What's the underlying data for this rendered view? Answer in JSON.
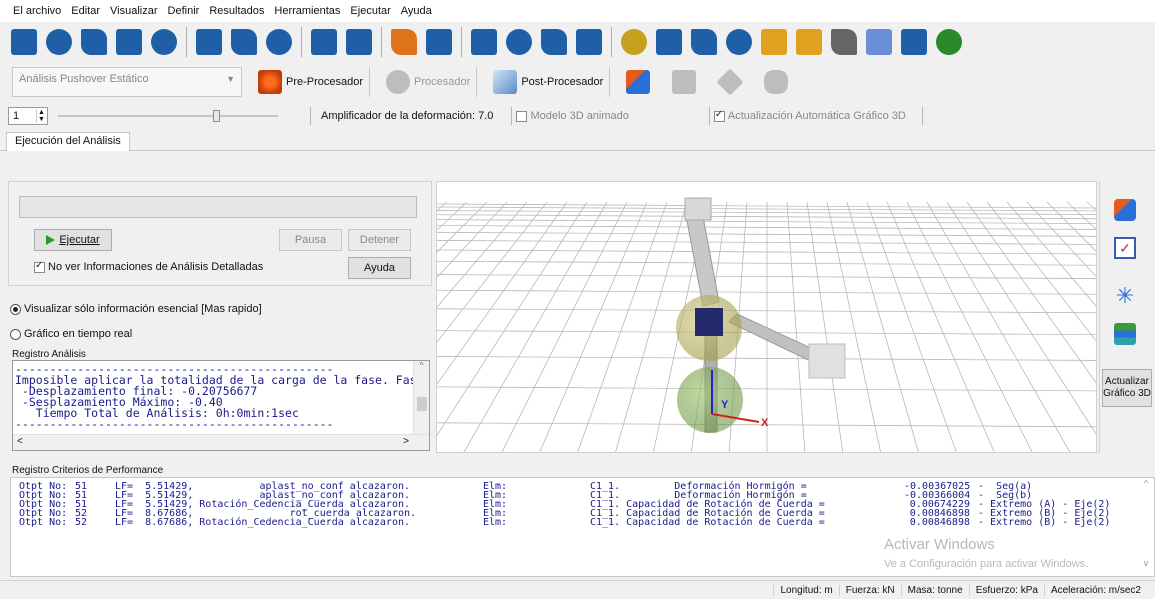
{
  "menu": [
    "El archivo",
    "Editar",
    "Visualizar",
    "Definir",
    "Resultados",
    "Herramientas",
    "Ejecutar",
    "Ayuda"
  ],
  "toolbar_icons": [
    {
      "name": "new-icon",
      "color": "#1f5fa8"
    },
    {
      "name": "open-icon",
      "color": "#1f5fa8"
    },
    {
      "name": "save-icon",
      "color": "#1f5fa8"
    },
    {
      "name": "properties-icon",
      "color": "#1f5fa8"
    },
    {
      "name": "disk-icon",
      "color": "#1f5fa8"
    },
    {
      "name": "report-icon",
      "color": "#1f5fa8"
    },
    {
      "name": "print-icon",
      "color": "#1f5fa8"
    },
    {
      "name": "print-preview-icon",
      "color": "#1f5fa8"
    },
    {
      "name": "undo-icon",
      "color": "#1f5fa8"
    },
    {
      "name": "redo-icon",
      "color": "#1f5fa8"
    },
    {
      "name": "table-icon",
      "color": "#e0721a"
    },
    {
      "name": "table-edit-icon",
      "color": "#1f5fa8"
    },
    {
      "name": "tree-icon",
      "color": "#1f5fa8"
    },
    {
      "name": "stop-icon",
      "color": "#1f5fa8"
    },
    {
      "name": "settings-icon",
      "color": "#1f5fa8"
    },
    {
      "name": "gear-icon",
      "color": "#1f5fa8"
    },
    {
      "name": "brush-icon",
      "color": "#c8a020"
    },
    {
      "name": "help-icon",
      "color": "#1f5fa8"
    },
    {
      "name": "book-icon",
      "color": "#1f5fa8"
    },
    {
      "name": "book-check-icon",
      "color": "#1f5fa8"
    },
    {
      "name": "folder-icon",
      "color": "#e0a020"
    },
    {
      "name": "chat-icon",
      "color": "#e0a020"
    },
    {
      "name": "film-icon",
      "color": "#666666"
    },
    {
      "name": "speech-icon",
      "color": "#6b8fd6"
    },
    {
      "name": "pen-icon",
      "color": "#1f5fa8"
    },
    {
      "name": "globe-icon",
      "color": "#2a8a2a"
    }
  ],
  "analysis_type": "Análisis Pushover Estático",
  "modes": {
    "pre": "Pre-Procesador",
    "proc": "Procesador",
    "post": "Post-Procesador"
  },
  "toolbar3": {
    "step_value": "1",
    "slider_fraction": 0.73,
    "amplifier": "Amplificador de la deformación: 7.0",
    "model3d": "Modelo 3D animado",
    "autoupdate": "Actualización Automática Gráfico 3D"
  },
  "tab": "Ejecución del Análisis",
  "controls": {
    "run": "Ejecutar",
    "pause": "Pausa",
    "stop": "Detener",
    "no_info": "No ver Informaciones de Análisis Detalladas",
    "help": "Ayuda",
    "opt_essential": "Visualizar sólo información esencial [Mas rapido]",
    "opt_realtime": "Gráfico en tiempo real"
  },
  "registro_label": "Registro Análisis",
  "console_lines": [
    "----------------------------------------------",
    "Imposible aplicar la totalidad de la carga de la fase. Fase",
    " -Desplazamiento final: -0.20756677",
    " -Sesplazamiento Máximo: -0.40",
    "   Tiempo Total de Análisis: 0h:0min:1sec",
    "----------------------------------------------"
  ],
  "view3d": {
    "axis_x": "X",
    "axis_y": "Y",
    "x_color": "#d62020",
    "y_color": "#2020d6"
  },
  "side": {
    "update": "Actualizar Gráfico 3D"
  },
  "performance_label": "Registro Criterios de Performance",
  "performance_rows": [
    [
      "Otpt No:",
      "51",
      "LF=  5.51429,           aplast_no_conf alcazaron.",
      "Elm:",
      "C1_1.         Deformación Hormigón =",
      "-0.00367025",
      "-  Seg(a)"
    ],
    [
      "Otpt No:",
      "51",
      "LF=  5.51429,           aplast_no_conf alcazaron.",
      "Elm:",
      "C1_1.         Deformación Hormigón =",
      "-0.00366004",
      "-  Seg(b)"
    ],
    [
      "Otpt No:",
      "51",
      "LF=  5.51429, Rotación_Cedencia_Cuerda alcazaron.",
      "Elm:",
      "C1_1. Capacidad de Rotación de Cuerda =",
      "0.00674229",
      "- Extremo (A) - Eje(2)"
    ],
    [
      "Otpt No:",
      "52",
      "LF=  8.67686,                rot_cuerda alcazaron.",
      "Elm:",
      "C1_1. Capacidad de Rotación de Cuerda =",
      "0.00846898",
      "- Extremo (B) - Eje(2)"
    ],
    [
      "Otpt No:",
      "52",
      "LF=  8.67686, Rotación_Cedencia_Cuerda alcazaron.",
      "Elm:",
      "C1_1. Capacidad de Rotación de Cuerda =",
      "0.00846898",
      "- Extremo (B) - Eje(2)"
    ]
  ],
  "watermark": {
    "title": "Activar Windows",
    "sub": "Ve a Configuración para activar Windows."
  },
  "status": {
    "length": "Longitud: m",
    "force": "Fuerza: kN",
    "mass": "Masa: tonne",
    "stress": "Esfuerzo: kPa",
    "accel": "Aceleración: m/sec2"
  }
}
